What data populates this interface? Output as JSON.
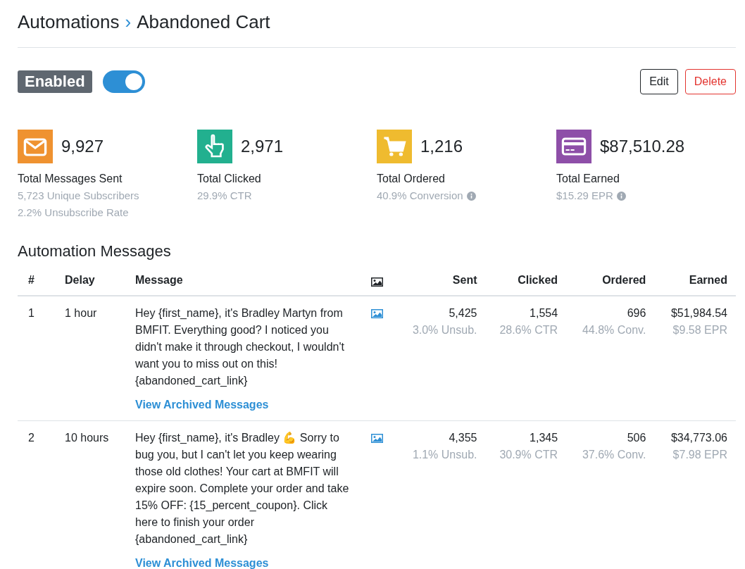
{
  "breadcrumb": {
    "parent": "Automations",
    "separator": "›",
    "current": "Abandoned Cart"
  },
  "status": {
    "label": "Enabled",
    "on": true
  },
  "actions": [
    {
      "label": "Edit",
      "kind": "default"
    },
    {
      "label": "Delete",
      "kind": "danger"
    }
  ],
  "stats": [
    {
      "kind": "mail",
      "color": "#ef9230",
      "value": "9,927",
      "label": "Total Messages Sent",
      "details": [
        "5,723 Unique Subscribers",
        "2.2% Unsubscribe Rate"
      ],
      "info": false
    },
    {
      "kind": "pointer",
      "color": "#22b08f",
      "value": "2,971",
      "label": "Total Clicked",
      "details": [
        "29.9% CTR"
      ],
      "info": false
    },
    {
      "kind": "cart",
      "color": "#efbb2f",
      "value": "1,216",
      "label": "Total Ordered",
      "details": [
        "40.9% Conversion"
      ],
      "info": true
    },
    {
      "kind": "card",
      "color": "#8e4fa8",
      "value": "$87,510.28",
      "label": "Total Earned",
      "details": [
        "$15.29 EPR"
      ],
      "info": true
    }
  ],
  "section_title": "Automation Messages",
  "table": {
    "columns": [
      "#",
      "Delay",
      "Message",
      "",
      "Sent",
      "Clicked",
      "Ordered",
      "Earned"
    ],
    "rows": [
      {
        "number": "1",
        "delay": "1 hour",
        "message": "Hey {first_name}, it's Bradley Martyn from BMFIT. Everything good? I noticed you didn't make it through checkout, I wouldn't want you to miss out on this! {abandoned_cart_link}",
        "link": "View Archived Messages",
        "has_image": true,
        "sent": "5,425",
        "sent_sub": "3.0% Unsub.",
        "clicked": "1,554",
        "clicked_sub": "28.6% CTR",
        "ordered": "696",
        "ordered_sub": "44.8% Conv.",
        "earned": "$51,984.54",
        "earned_sub": "$9.58 EPR"
      },
      {
        "number": "2",
        "delay": "10 hours",
        "message": "Hey {first_name}, it's Bradley 💪 Sorry to bug you, but I can't let you keep wearing those old clothes! Your cart at BMFIT will expire soon. Complete your order and take 15% OFF: {15_percent_coupon}. Click here to finish your order {abandoned_cart_link}",
        "link": "View Archived Messages",
        "has_image": true,
        "sent": "4,355",
        "sent_sub": "1.1% Unsub.",
        "clicked": "1,345",
        "clicked_sub": "30.9% CTR",
        "ordered": "506",
        "ordered_sub": "37.6% Conv.",
        "earned": "$34,773.06",
        "earned_sub": "$7.98 EPR"
      }
    ]
  }
}
